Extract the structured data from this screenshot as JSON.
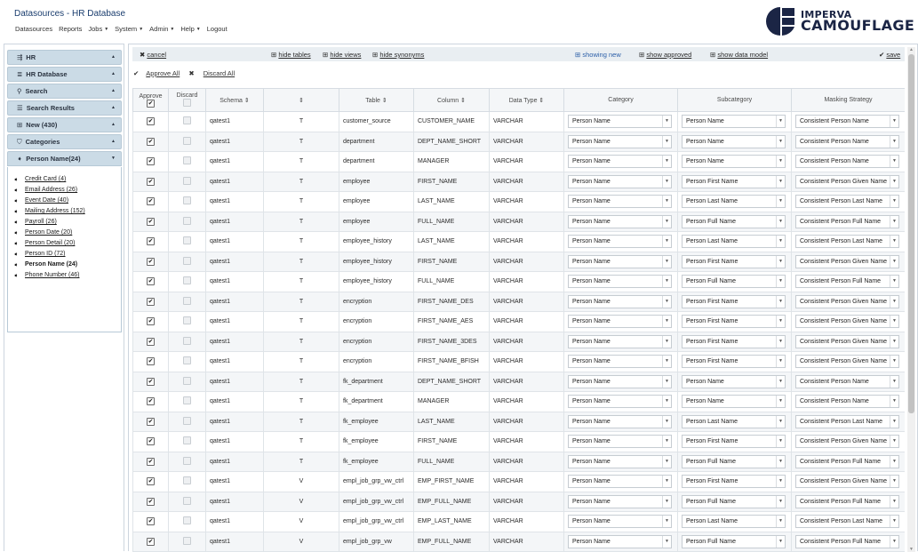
{
  "app": {
    "title": "Datasources - HR Database"
  },
  "nav": [
    {
      "label": "Datasources",
      "caret": false
    },
    {
      "label": "Reports",
      "caret": false
    },
    {
      "label": "Jobs",
      "caret": true
    },
    {
      "label": "System",
      "caret": true
    },
    {
      "label": "Admin",
      "caret": true
    },
    {
      "label": "Help",
      "caret": true
    },
    {
      "label": "Logout",
      "caret": false
    }
  ],
  "logo": {
    "line1": "IMPERVA",
    "line2": "CAMOUFLAGE"
  },
  "sidebar": {
    "sections": [
      {
        "label": "HR",
        "icon": "datasource-icon"
      },
      {
        "label": "HR Database",
        "icon": "database-icon"
      },
      {
        "label": "Search",
        "icon": "search-icon"
      },
      {
        "label": "Search Results",
        "icon": "list-icon"
      },
      {
        "label": "New (430)",
        "icon": "new-icon"
      },
      {
        "label": "Categories",
        "icon": "tags-icon"
      },
      {
        "label": "Person Name(24)",
        "icon": "tag-icon"
      }
    ],
    "categories": [
      "Credit Card (4)",
      "Email Address (26)",
      "Event Date (40)",
      "Mailing Address (152)",
      "Payroll (26)",
      "Person Date (20)",
      "Person Detail (20)",
      "Person ID (72)",
      "Person Name (24)",
      "Phone Number (46)"
    ],
    "active_category": "Person Name (24)"
  },
  "toolbar": {
    "cancel": "cancel",
    "hide_tables": "hide tables",
    "hide_views": "hide views",
    "hide_synonyms": "hide synonyms",
    "showing_new": "showing new",
    "show_approved": "show approved",
    "show_data_model": "show data model",
    "save": "save"
  },
  "actions": {
    "approve_all": "Approve All",
    "discard_all": "Discard All"
  },
  "columns": {
    "approve": "Approve",
    "discard": "Discard",
    "schema": "Schema",
    "type": "",
    "table": "Table",
    "column": "Column",
    "data_type": "Data Type",
    "category": "Category",
    "subcategory": "Subcategory",
    "masking": "Masking Strategy"
  },
  "rows": [
    {
      "schema": "qatest1",
      "type": "T",
      "table": "customer_source",
      "column": "CUSTOMER_NAME",
      "dtype": "VARCHAR",
      "category": "Person Name",
      "subcategory": "Person Name",
      "masking": "Consistent Person Name"
    },
    {
      "schema": "qatest1",
      "type": "T",
      "table": "department",
      "column": "DEPT_NAME_SHORT",
      "dtype": "VARCHAR",
      "category": "Person Name",
      "subcategory": "Person Name",
      "masking": "Consistent Person Name"
    },
    {
      "schema": "qatest1",
      "type": "T",
      "table": "department",
      "column": "MANAGER",
      "dtype": "VARCHAR",
      "category": "Person Name",
      "subcategory": "Person Name",
      "masking": "Consistent Person Name"
    },
    {
      "schema": "qatest1",
      "type": "T",
      "table": "employee",
      "column": "FIRST_NAME",
      "dtype": "VARCHAR",
      "category": "Person Name",
      "subcategory": "Person First Name",
      "masking": "Consistent Person Given Name"
    },
    {
      "schema": "qatest1",
      "type": "T",
      "table": "employee",
      "column": "LAST_NAME",
      "dtype": "VARCHAR",
      "category": "Person Name",
      "subcategory": "Person Last Name",
      "masking": "Consistent Person Last Name"
    },
    {
      "schema": "qatest1",
      "type": "T",
      "table": "employee",
      "column": "FULL_NAME",
      "dtype": "VARCHAR",
      "category": "Person Name",
      "subcategory": "Person Full Name",
      "masking": "Consistent Person Full Name"
    },
    {
      "schema": "qatest1",
      "type": "T",
      "table": "employee_history",
      "column": "LAST_NAME",
      "dtype": "VARCHAR",
      "category": "Person Name",
      "subcategory": "Person Last Name",
      "masking": "Consistent Person Last Name"
    },
    {
      "schema": "qatest1",
      "type": "T",
      "table": "employee_history",
      "column": "FIRST_NAME",
      "dtype": "VARCHAR",
      "category": "Person Name",
      "subcategory": "Person First Name",
      "masking": "Consistent Person Given Name"
    },
    {
      "schema": "qatest1",
      "type": "T",
      "table": "employee_history",
      "column": "FULL_NAME",
      "dtype": "VARCHAR",
      "category": "Person Name",
      "subcategory": "Person Full Name",
      "masking": "Consistent Person Full Name"
    },
    {
      "schema": "qatest1",
      "type": "T",
      "table": "encryption",
      "column": "FIRST_NAME_DES",
      "dtype": "VARCHAR",
      "category": "Person Name",
      "subcategory": "Person First Name",
      "masking": "Consistent Person Given Name"
    },
    {
      "schema": "qatest1",
      "type": "T",
      "table": "encryption",
      "column": "FIRST_NAME_AES",
      "dtype": "VARCHAR",
      "category": "Person Name",
      "subcategory": "Person First Name",
      "masking": "Consistent Person Given Name"
    },
    {
      "schema": "qatest1",
      "type": "T",
      "table": "encryption",
      "column": "FIRST_NAME_3DES",
      "dtype": "VARCHAR",
      "category": "Person Name",
      "subcategory": "Person First Name",
      "masking": "Consistent Person Given Name"
    },
    {
      "schema": "qatest1",
      "type": "T",
      "table": "encryption",
      "column": "FIRST_NAME_BFISH",
      "dtype": "VARCHAR",
      "category": "Person Name",
      "subcategory": "Person First Name",
      "masking": "Consistent Person Given Name"
    },
    {
      "schema": "qatest1",
      "type": "T",
      "table": "fk_department",
      "column": "DEPT_NAME_SHORT",
      "dtype": "VARCHAR",
      "category": "Person Name",
      "subcategory": "Person Name",
      "masking": "Consistent Person Name"
    },
    {
      "schema": "qatest1",
      "type": "T",
      "table": "fk_department",
      "column": "MANAGER",
      "dtype": "VARCHAR",
      "category": "Person Name",
      "subcategory": "Person Name",
      "masking": "Consistent Person Name"
    },
    {
      "schema": "qatest1",
      "type": "T",
      "table": "fk_employee",
      "column": "LAST_NAME",
      "dtype": "VARCHAR",
      "category": "Person Name",
      "subcategory": "Person Last Name",
      "masking": "Consistent Person Last Name"
    },
    {
      "schema": "qatest1",
      "type": "T",
      "table": "fk_employee",
      "column": "FIRST_NAME",
      "dtype": "VARCHAR",
      "category": "Person Name",
      "subcategory": "Person First Name",
      "masking": "Consistent Person Given Name"
    },
    {
      "schema": "qatest1",
      "type": "T",
      "table": "fk_employee",
      "column": "FULL_NAME",
      "dtype": "VARCHAR",
      "category": "Person Name",
      "subcategory": "Person Full Name",
      "masking": "Consistent Person Full Name"
    },
    {
      "schema": "qatest1",
      "type": "V",
      "table": "empl_job_grp_vw_ctrl",
      "column": "EMP_FIRST_NAME",
      "dtype": "VARCHAR",
      "category": "Person Name",
      "subcategory": "Person First Name",
      "masking": "Consistent Person Given Name"
    },
    {
      "schema": "qatest1",
      "type": "V",
      "table": "empl_job_grp_vw_ctrl",
      "column": "EMP_FULL_NAME",
      "dtype": "VARCHAR",
      "category": "Person Name",
      "subcategory": "Person Full Name",
      "masking": "Consistent Person Full Name"
    },
    {
      "schema": "qatest1",
      "type": "V",
      "table": "empl_job_grp_vw_ctrl",
      "column": "EMP_LAST_NAME",
      "dtype": "VARCHAR",
      "category": "Person Name",
      "subcategory": "Person Last Name",
      "masking": "Consistent Person Last Name"
    },
    {
      "schema": "qatest1",
      "type": "V",
      "table": "empl_job_grp_vw",
      "column": "EMP_FULL_NAME",
      "dtype": "VARCHAR",
      "category": "Person Name",
      "subcategory": "Person Full Name",
      "masking": "Consistent Person Full Name"
    }
  ],
  "colors": {
    "accent": "#2c5fa8",
    "section_bg": "#cbdbe6",
    "brand": "#1b2545"
  }
}
